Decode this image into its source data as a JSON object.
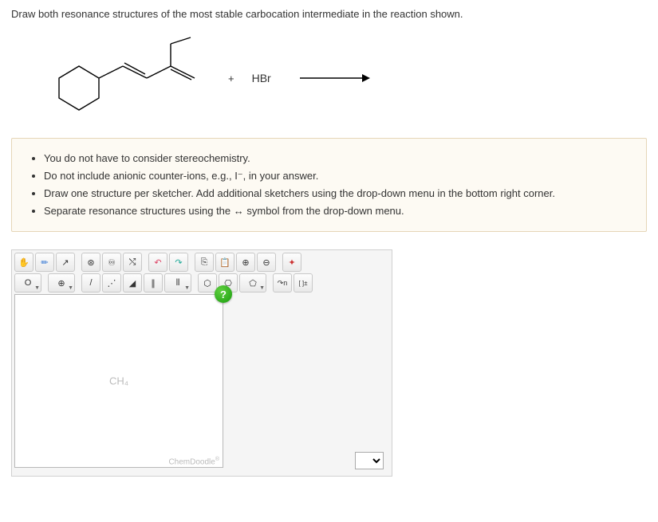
{
  "question": "Draw both resonance structures of the most stable carbocation intermediate in the reaction shown.",
  "reaction": {
    "plus": "+",
    "reagent": "HBr"
  },
  "instructions": [
    "You do not have to consider stereochemistry.",
    "Do not include anionic counter-ions, e.g., I⁻, in your answer.",
    "Draw one structure per sketcher. Add additional sketchers using the drop-down menu in the bottom right corner.",
    "Separate resonance structures using the ↔ symbol from the drop-down menu."
  ],
  "toolbar": {
    "row1": {
      "hand": "✋",
      "erase": "✏",
      "lasso": "↗",
      "center": "⊛",
      "clean": "♾",
      "flip": "⤭",
      "undo": "↶",
      "redo": "↷",
      "copy": "⎘",
      "paste": "📋",
      "zoomin": "⊕",
      "zoomout": "⊖",
      "search": "✦"
    },
    "row2": {
      "atom_o": "O",
      "charge": "⊕",
      "single": "/",
      "dashed": "⋰",
      "wedge": "◢",
      "double": "∥",
      "triple": "⫴",
      "ring6": "⬡",
      "benzene": "⎔",
      "ring5": "⬠",
      "curve": "↷n",
      "bracket": "[ ]±"
    }
  },
  "canvas": {
    "placeholder": "CH₄",
    "brand": "ChemDoodle",
    "help": "?"
  }
}
